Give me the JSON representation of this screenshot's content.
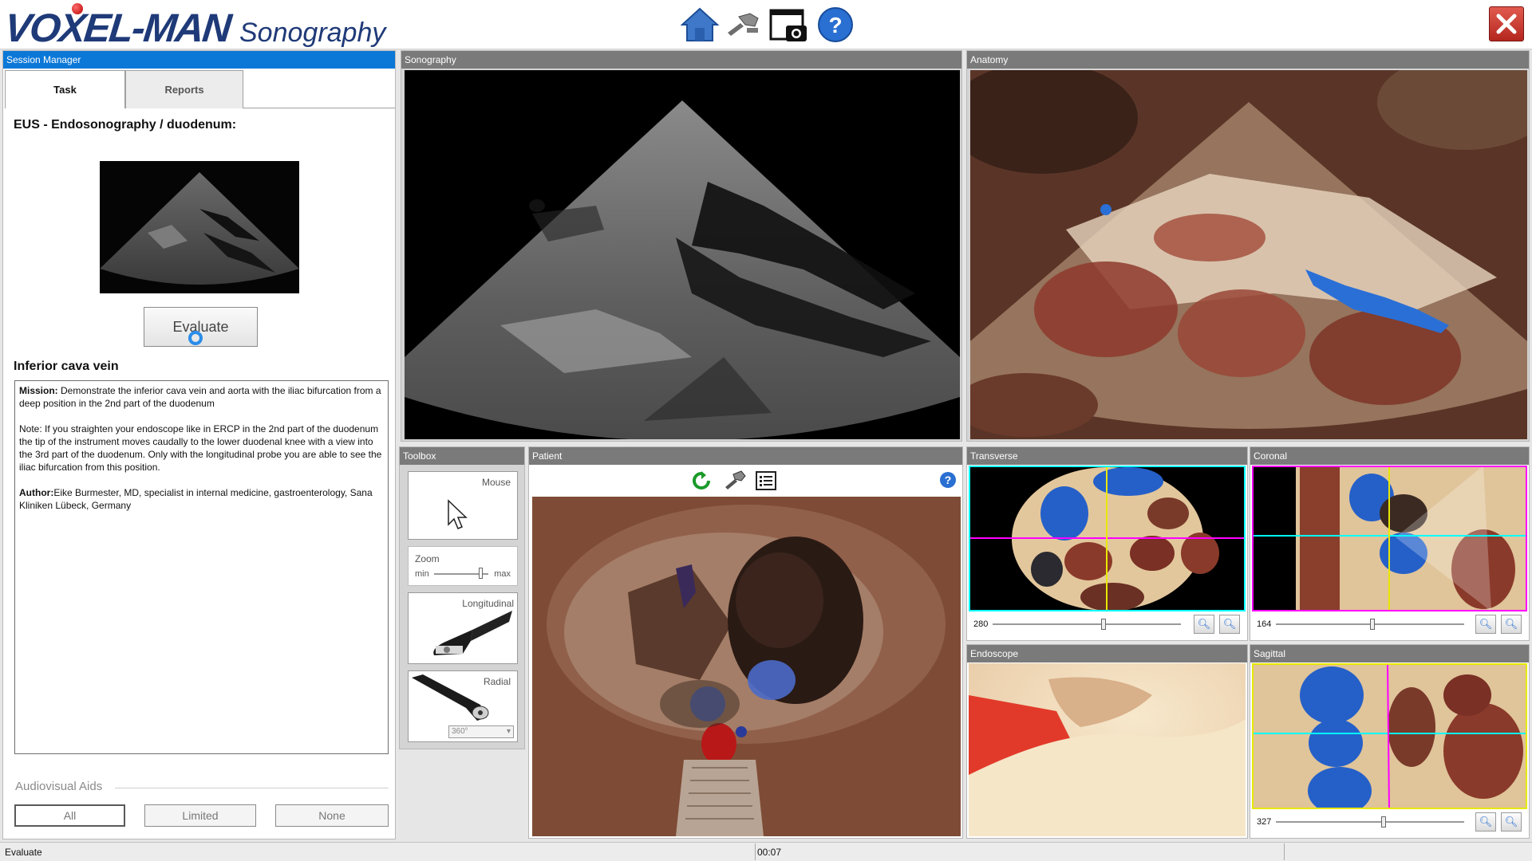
{
  "app": {
    "logo_main": "VOXEL-MAN",
    "logo_sub": "Sonography"
  },
  "header_icons": [
    "home-icon",
    "tool-settings-icon",
    "screenshot-camera-icon",
    "help-icon"
  ],
  "session_manager": {
    "title": "Session Manager",
    "tabs": [
      {
        "label": "Task",
        "selected": true
      },
      {
        "label": "Reports",
        "selected": false
      }
    ],
    "task_title": "EUS - Endosonography / duodenum:",
    "evaluate_label": "Evaluate",
    "subtask_title": "Inferior cava vein",
    "mission_label": "Mission:",
    "mission_text": " Demonstrate the inferior cava vein and aorta with the iliac bifurcation from a deep position in the 2nd part of the duodenum",
    "note_text": "Note: If you straighten your endoscope like in ERCP in the 2nd part of the duodenum the tip of the instrument moves caudally to the lower duodenal knee with a view into the 3rd part of the duodenum. Only with the longitudinal probe you are able to see the iliac bifurcation from this position.",
    "author_label": "Author:",
    "author_text": "Eike Burmester, MD, specialist in internal medicine, gastroenterology, Sana Kliniken Lübeck, Germany",
    "av_label": "Audiovisual Aids",
    "av_options": [
      "All",
      "Limited",
      "None"
    ],
    "av_selected": "All"
  },
  "panels": {
    "sonography": "Sonography",
    "anatomy": "Anatomy",
    "toolbox": "Toolbox",
    "patient": "Patient",
    "transverse": "Transverse",
    "coronal": "Coronal",
    "endoscope": "Endoscope",
    "sagittal": "Sagittal"
  },
  "toolbox": {
    "mouse": "Mouse",
    "zoom": "Zoom",
    "zoom_min": "min",
    "zoom_max": "max",
    "zoom_level": 0.85,
    "longitudinal": "Longitudinal",
    "radial": "Radial",
    "radial_select": "360°"
  },
  "views": {
    "transverse_value": "280",
    "coronal_value": "164",
    "sagittal_value": "327"
  },
  "status": {
    "text": "Evaluate",
    "time": "00:07"
  },
  "colors": {
    "accent": "#0b78d8",
    "panel_title": "#7a7a7a",
    "logo": "#1f3a78"
  }
}
